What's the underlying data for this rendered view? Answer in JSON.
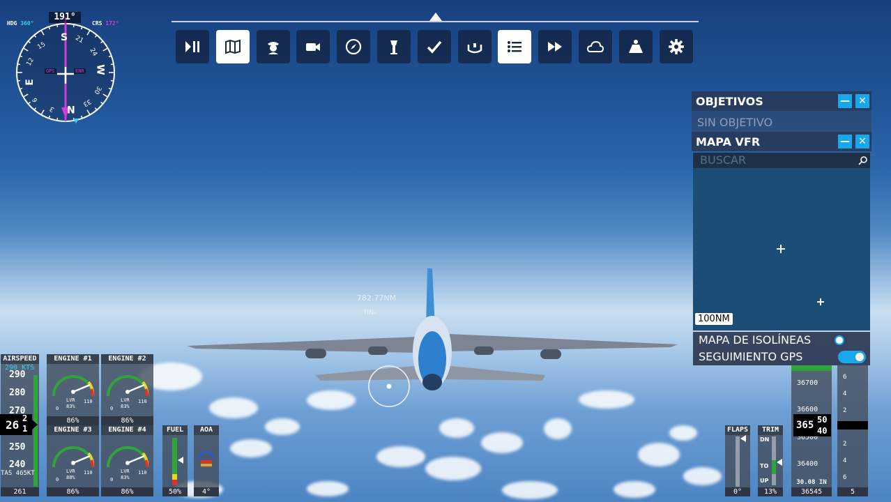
{
  "compass": {
    "heading": "191°",
    "hdg_label": "HDG",
    "hdg_value": "360°",
    "crs_label": "CRS",
    "crs_value": "172°",
    "gps": "GPS",
    "enr": "ENR",
    "cardinals": [
      "S",
      "W",
      "N",
      "E"
    ],
    "numbers": [
      "21",
      "24",
      "30",
      "33",
      "3",
      "6",
      "12",
      "15"
    ]
  },
  "toolbar": {
    "buttons": [
      {
        "name": "pause-play",
        "icon": "play-pause-icon",
        "active": false
      },
      {
        "name": "map",
        "icon": "map-icon",
        "active": true
      },
      {
        "name": "atc",
        "icon": "pilot-icon",
        "active": false
      },
      {
        "name": "camera",
        "icon": "camera-icon",
        "active": false
      },
      {
        "name": "navlog",
        "icon": "compass-icon",
        "active": false
      },
      {
        "name": "weather-tower",
        "icon": "tower-icon",
        "active": false
      },
      {
        "name": "checklist",
        "icon": "check-icon",
        "active": false
      },
      {
        "name": "controls",
        "icon": "yoke-icon",
        "active": false
      },
      {
        "name": "objectives",
        "icon": "list-icon",
        "active": true
      },
      {
        "name": "sim-rate",
        "icon": "fast-forward-icon",
        "active": false
      },
      {
        "name": "weather",
        "icon": "cloud-icon",
        "active": false
      },
      {
        "name": "weight",
        "icon": "weight-icon",
        "active": false
      },
      {
        "name": "settings",
        "icon": "gear-icon",
        "active": false
      }
    ]
  },
  "objectives": {
    "title": "OBJETIVOS",
    "empty": "SIN OBJETIVO",
    "minimize": "—",
    "close": "✕"
  },
  "vfr_map": {
    "title": "MAPA VFR",
    "search_placeholder": "BUSCAR",
    "scale": "100NM",
    "minimize": "—",
    "close": "✕",
    "isolines_label": "MAPA DE ISOLÍNEAS",
    "isolines_on": false,
    "gps_follow_label": "SEGUIMIENTO GPS",
    "gps_follow_on": true
  },
  "waypoint": {
    "distance": "782.77NM",
    "sub": "TIN-"
  },
  "airspeed": {
    "title": "AIRSPEED",
    "target": "290 KTS",
    "ticks": [
      "290",
      "280",
      "270",
      "250",
      "240"
    ],
    "current_main": "26",
    "current_roll_top": "2",
    "current_roll_bottom": "1",
    "tas": "TAS 465KT",
    "footer": "261"
  },
  "engines": [
    {
      "title": "ENGINE #1",
      "lvr": "LVR",
      "pct": "83%",
      "zero": "0",
      "max": "110",
      "footer": "86%"
    },
    {
      "title": "ENGINE #2",
      "lvr": "LVR",
      "pct": "83%",
      "zero": "0",
      "max": "110",
      "footer": "86%"
    },
    {
      "title": "ENGINE #3",
      "lvr": "LVR",
      "pct": "88%",
      "zero": "0",
      "max": "110",
      "footer": "86%"
    },
    {
      "title": "ENGINE #4",
      "lvr": "LVR",
      "pct": "83%",
      "zero": "0",
      "max": "110",
      "footer": "86%"
    }
  ],
  "fuel": {
    "title": "FUEL",
    "footer": "50%"
  },
  "aoa": {
    "title": "AOA",
    "footer": "4°"
  },
  "flaps": {
    "title": "FLAPS",
    "footer": "0°"
  },
  "trim": {
    "title": "TRIM",
    "dn": "DN",
    "to": "TO",
    "up": "UP",
    "footer": "13%"
  },
  "altimeter": {
    "ticks": [
      "36700",
      "36600",
      "36500",
      "36400"
    ],
    "current_main": "365",
    "current_roll_top": "50",
    "current_roll_bottom": "40",
    "baro": "30.08 IN",
    "footer": "36545"
  },
  "vsi": {
    "ticks": [
      "6",
      "4",
      "2",
      "0",
      "2",
      "4",
      "6"
    ],
    "footer": "5"
  }
}
